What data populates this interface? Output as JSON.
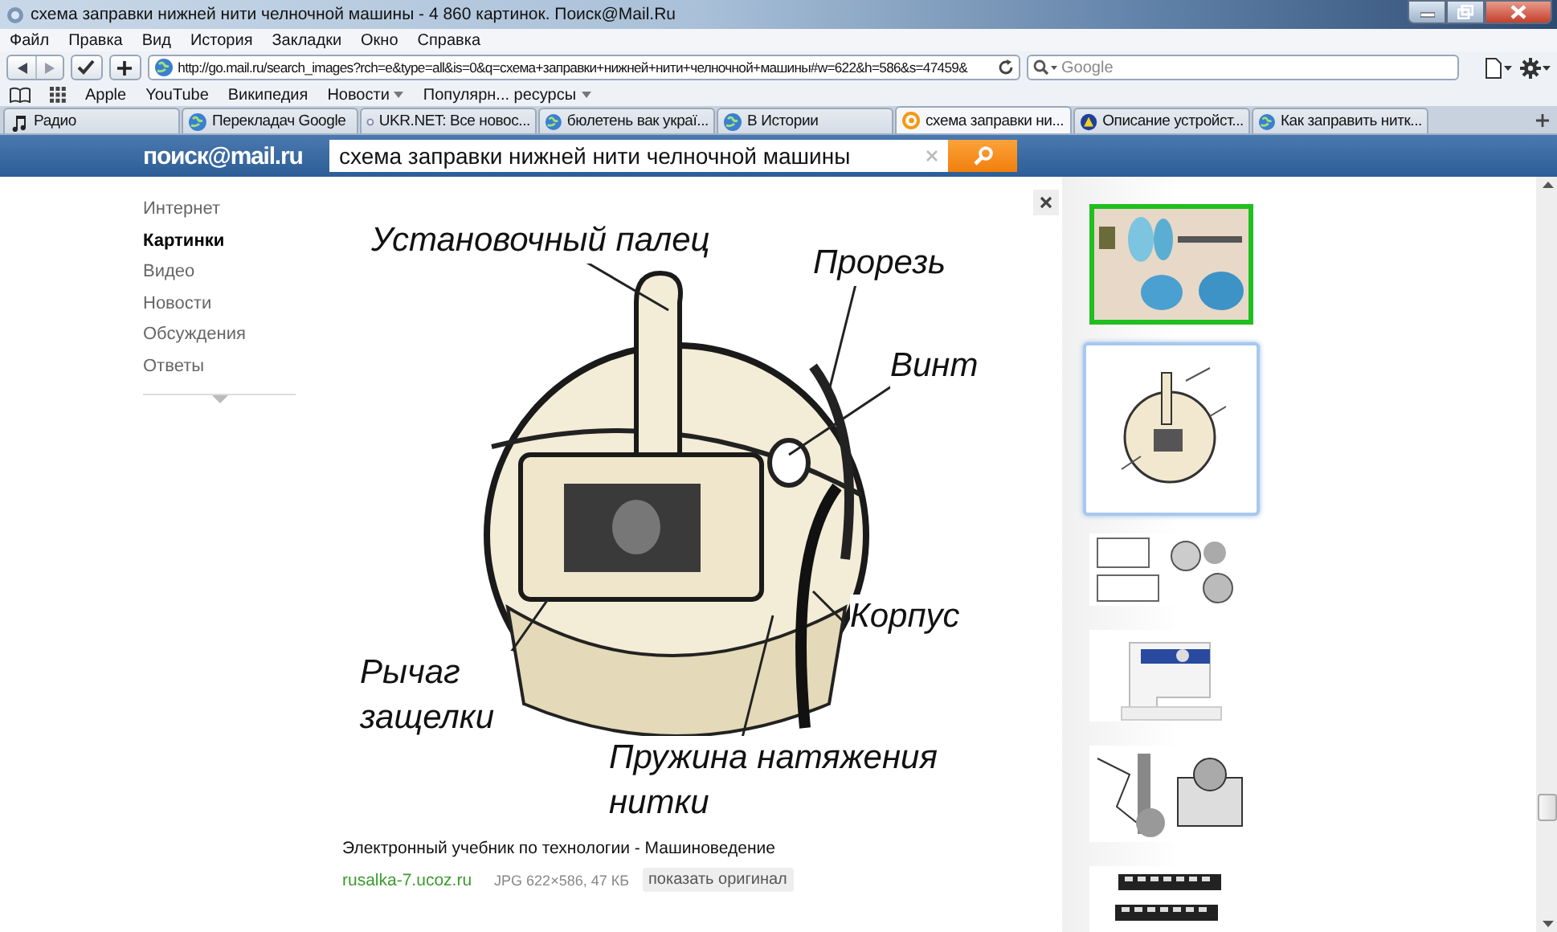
{
  "window": {
    "title": "схема заправки нижней нити челночной машины - 4 860 картинок. Поиск@Mail.Ru"
  },
  "menu": [
    "Файл",
    "Правка",
    "Вид",
    "История",
    "Закладки",
    "Окно",
    "Справка"
  ],
  "toolbar": {
    "address": "http://go.mail.ru/search_images?rch=e&type=all&is=0&q=схема+заправки+нижней+нити+челночной+машины#w=622&h=586&s=47459&",
    "search_placeholder": "Google"
  },
  "bookmarks": [
    {
      "label": "Apple",
      "menu": false
    },
    {
      "label": "YouTube",
      "menu": false
    },
    {
      "label": "Википедия",
      "menu": false
    },
    {
      "label": "Новости",
      "menu": true
    },
    {
      "label": "Популярн... ресурсы",
      "menu": true
    }
  ],
  "tabs": [
    {
      "label": "Радио",
      "kind": "music",
      "selected": false
    },
    {
      "label": "Перекладач Google",
      "kind": "globe",
      "selected": false
    },
    {
      "label": "UKR.NET: Все новос...",
      "kind": "ukr",
      "selected": false
    },
    {
      "label": "бюлетень вак украї...",
      "kind": "globe",
      "selected": false
    },
    {
      "label": "В Истории",
      "kind": "globe",
      "selected": false
    },
    {
      "label": "схема заправки ни...",
      "kind": "mail",
      "selected": true
    },
    {
      "label": "Описание устройст...",
      "kind": "triangle",
      "selected": false
    },
    {
      "label": "Как заправить нитк...",
      "kind": "globe",
      "selected": false
    }
  ],
  "page": {
    "logo": "поиск@mail.ru",
    "query": "схема заправки нижней нити челночной машины",
    "nav": [
      {
        "label": "Интернет",
        "selected": false
      },
      {
        "label": "Картинки",
        "selected": true
      },
      {
        "label": "Видео",
        "selected": false
      },
      {
        "label": "Новости",
        "selected": false
      },
      {
        "label": "Обсуждения",
        "selected": false
      },
      {
        "label": "Ответы",
        "selected": false
      }
    ],
    "image": {
      "kind": "picture",
      "labels": [
        "Установочный палец",
        "Прорезь",
        "Винт",
        "Корпус",
        "Рычаг защелки",
        "Пружина натяжения нитки"
      ]
    },
    "caption": {
      "title": "Электронный учебник по технологии - Машиноведение",
      "source": "rusalka-7.ucoz.ru",
      "info": "JPG 622×586, 47 КБ",
      "button": "показать оригинал"
    },
    "thumbnails": [
      {
        "kind": "picture",
        "selected": false
      },
      {
        "kind": "picture",
        "selected": true
      },
      {
        "kind": "picture",
        "selected": false
      },
      {
        "kind": "picture",
        "selected": false
      },
      {
        "kind": "picture",
        "selected": false
      },
      {
        "kind": "picture",
        "selected": false
      }
    ]
  }
}
